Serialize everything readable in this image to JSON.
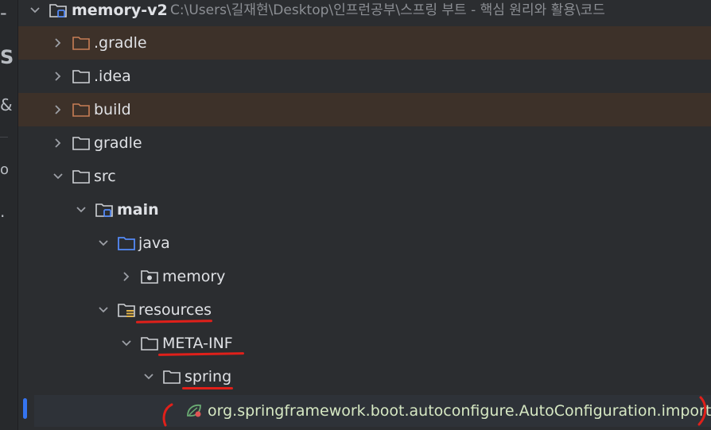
{
  "project": {
    "name": "memory-v2",
    "path": "C:\\Users\\길재현\\Desktop\\인프런공부\\스프링 부트 - 핵심 원리와 활용\\코드"
  },
  "tree": {
    "gradle_hidden": ".gradle",
    "idea": ".idea",
    "build": "build",
    "gradle": "gradle",
    "src": "src",
    "main": "main",
    "java": "java",
    "memory": "memory",
    "resources": "resources",
    "meta_inf": "META-INF",
    "spring": "spring",
    "imports_file": "org.springframework.boot.autoconfigure.AutoConfiguration.imports"
  },
  "colors": {
    "background": "#2b2d30",
    "ignored_row": "#3d3129",
    "selected_row": "#2e3238",
    "annotation_red": "#e0201a",
    "source_folder_blue": "#548af7",
    "excluded_folder_orange": "#c77d55"
  },
  "icons": {
    "module": "module-folder-icon",
    "folder": "folder-icon",
    "package": "package-icon",
    "resources": "resources-folder-icon",
    "spring_file": "spring-config-icon",
    "chevron_right": "chevron-right-icon",
    "chevron_down": "chevron-down-icon"
  }
}
